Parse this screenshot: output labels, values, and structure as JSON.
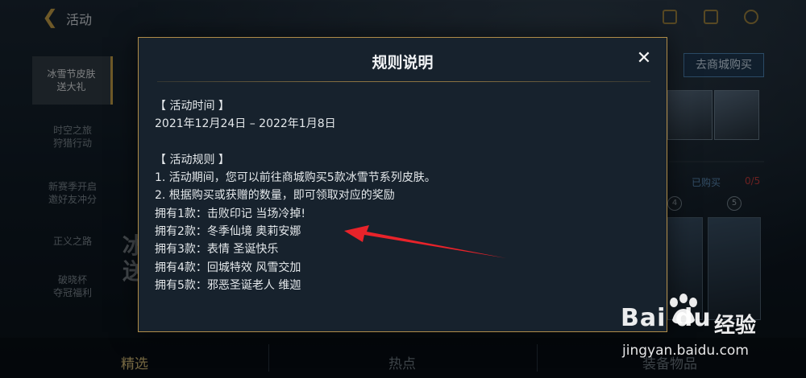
{
  "background": {
    "top_title": "活动",
    "sidebar_items": [
      {
        "label": "冰雪节皮肤\n送大礼",
        "active": true
      },
      {
        "label": "时空之旅\n狩猎行动",
        "active": false
      },
      {
        "label": "新赛季开启\n邀好友冲分",
        "active": false
      },
      {
        "label": "正义之路",
        "active": false
      },
      {
        "label": "破晓杯\n夺冠福利",
        "active": false
      }
    ],
    "banner_text": "冰\n送",
    "shop_button": "去商城购买",
    "owned_label": "已购买",
    "owned_count": "0/5",
    "nodes": [
      "4",
      "5"
    ],
    "bottom_tabs": [
      "精选",
      "热点",
      "装备物品"
    ]
  },
  "modal": {
    "title": "规则说明",
    "close_symbol": "✕",
    "lines": [
      "【 活动时间 】",
      "2021年12月24日 – 2022年1月8日",
      "",
      "【 活动规则 】",
      "1. 活动期间，您可以前往商城购买5款冰雪节系列皮肤。",
      "2. 根据购买或获赠的数量，即可领取对应的奖励",
      "拥有1款：击败印记 当场冷掉!",
      "拥有2款：冬季仙境 奥莉安娜",
      "拥有3款：表情 圣诞快乐",
      "拥有4款：回城特效 风雪交加",
      "拥有5款：邪恶圣诞老人 维迦"
    ]
  },
  "watermark": {
    "logo": "Bai  du",
    "suffix": "经验",
    "url": "jingyan.baidu.com"
  },
  "colors": {
    "accent_gold": "#c8a24a",
    "arrow_red": "#e8232a",
    "modal_bg": "#17222d"
  }
}
